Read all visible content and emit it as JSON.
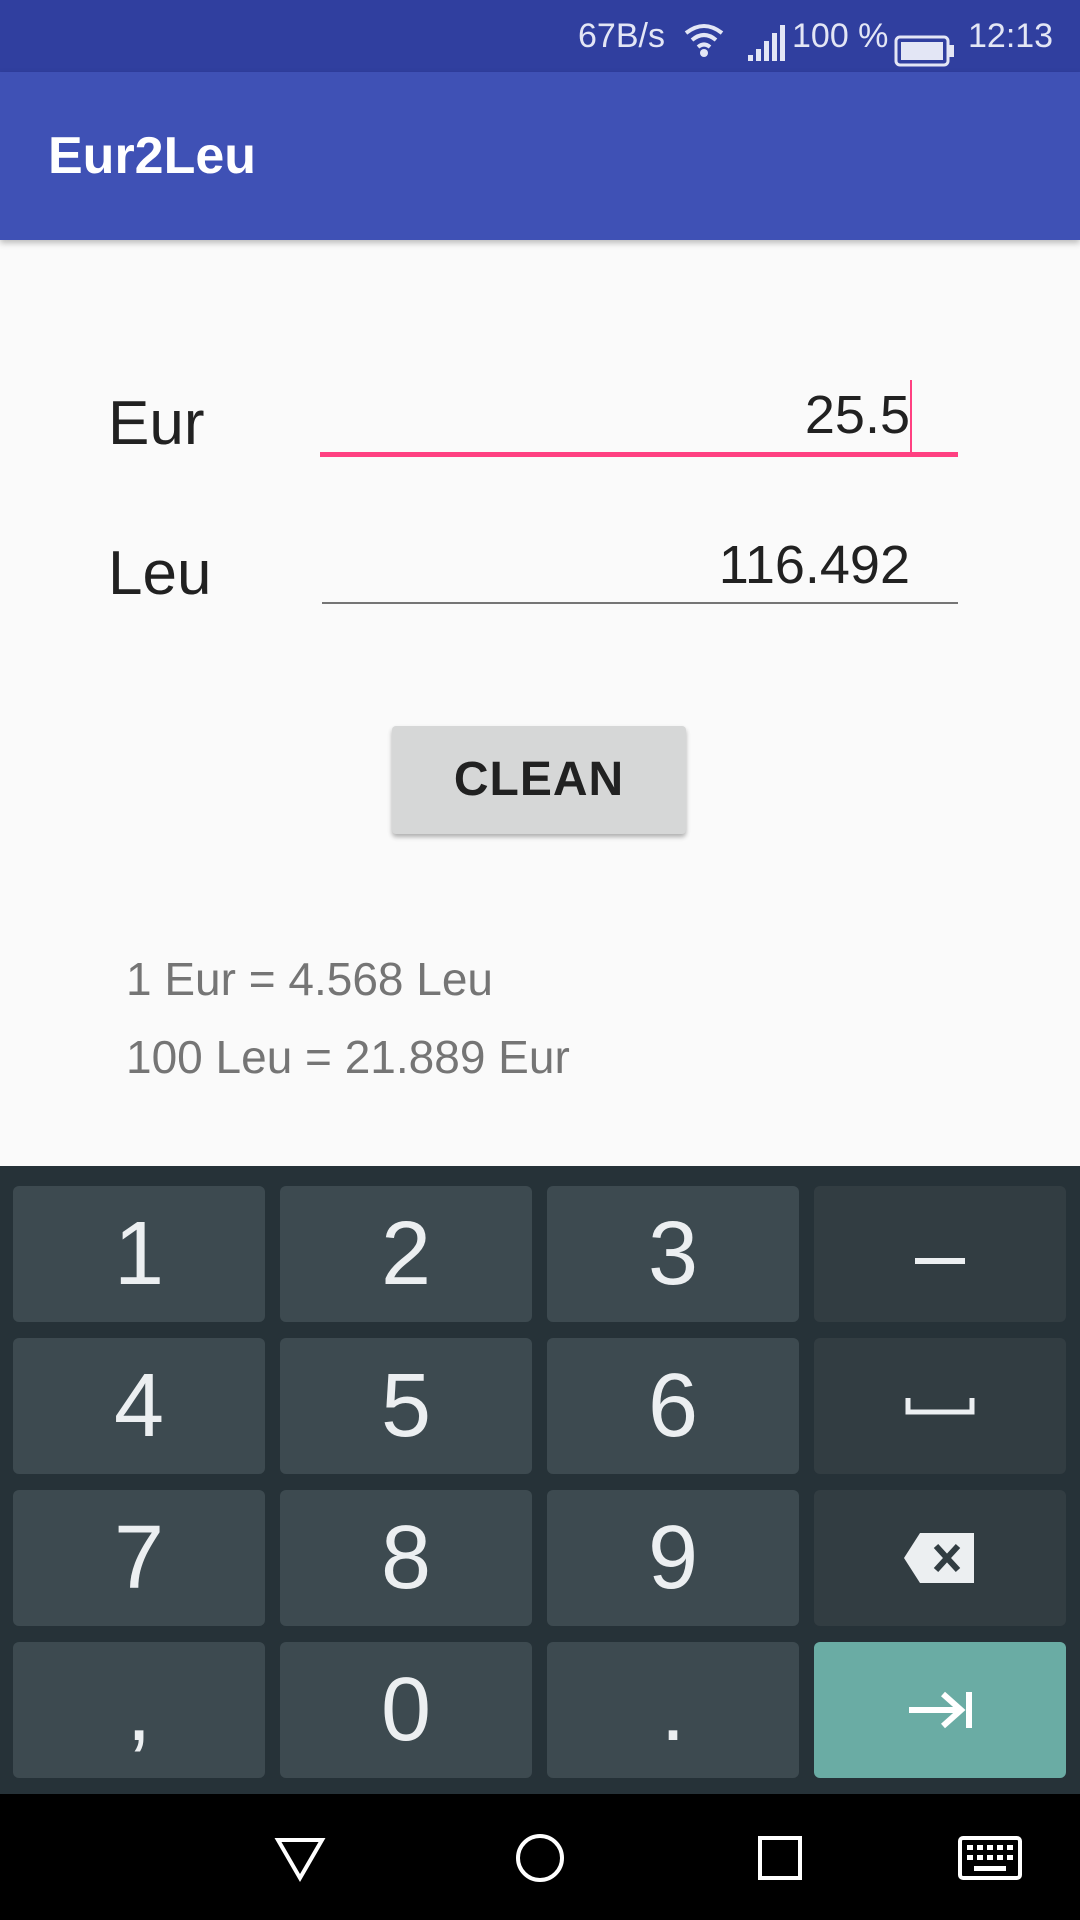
{
  "status_bar": {
    "speed": "67B/s",
    "battery": "100 %",
    "time": "12:13",
    "icons": [
      "wifi-icon",
      "signal-icon",
      "battery-icon"
    ]
  },
  "app_bar": {
    "title": "Eur2Leu"
  },
  "form": {
    "eur_label": "Eur",
    "eur_value": "25.5",
    "leu_label": "Leu",
    "leu_value": "116.492"
  },
  "clean_button": {
    "label": "CLEAN"
  },
  "rates": {
    "line1": "1 Eur = 4.568 Leu",
    "line2": "100 Leu = 21.889 Eur"
  },
  "keyboard": {
    "k1": "1",
    "k2": "2",
    "k3": "3",
    "minus": "–",
    "k4": "4",
    "k5": "5",
    "k6": "6",
    "k7": "7",
    "k8": "8",
    "k9": "9",
    "comma": ",",
    "k0": "0",
    "period": ".",
    "icons": [
      "space-icon",
      "backspace-icon",
      "next-tab-icon"
    ]
  },
  "nav_bar": {
    "icons": [
      "back-icon",
      "home-icon",
      "recents-icon",
      "keyboard-icon"
    ]
  },
  "colors": {
    "status_bar": "#303f9f",
    "app_bar": "#3f51b5",
    "accent": "#ff4081",
    "keyboard_bg": "#263238",
    "key": "#3d4a50",
    "enter_key": "#6aaca4"
  }
}
